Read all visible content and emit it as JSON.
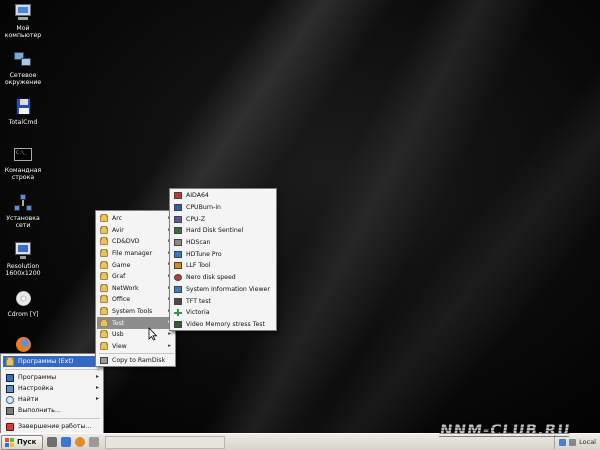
{
  "desktop": {
    "icons": [
      {
        "label": "Мой компьютер",
        "icon": "computer-icon"
      },
      {
        "label": "Сетевое окружение",
        "icon": "network-icon"
      },
      {
        "label": "TotalCmd",
        "icon": "total-commander-icon"
      },
      {
        "label": "Командная строка",
        "icon": "command-prompt-icon"
      },
      {
        "label": "Установка сети",
        "icon": "network-setup-icon"
      },
      {
        "label": "Resolution 1600x1200",
        "icon": "monitor-icon"
      },
      {
        "label": "Cdrom [Y]",
        "icon": "cdrom-icon"
      },
      {
        "label": "",
        "icon": "firefox-icon"
      }
    ]
  },
  "start_menu": {
    "items": [
      {
        "label": "Программы (Ext)",
        "icon": "programs-ext-icon",
        "has_submenu": true,
        "selected": true
      },
      {
        "label": "Программы",
        "icon": "programs-icon",
        "has_submenu": true
      },
      {
        "label": "Настройка",
        "icon": "settings-icon",
        "has_submenu": true
      },
      {
        "label": "Найти",
        "icon": "search-icon",
        "has_submenu": true
      },
      {
        "label": "Выполнить...",
        "icon": "run-icon"
      },
      {
        "label": "Завершение работы...",
        "icon": "shutdown-icon"
      }
    ]
  },
  "programs_menu": {
    "items": [
      {
        "label": "Arc",
        "has_submenu": true
      },
      {
        "label": "Avir",
        "has_submenu": true
      },
      {
        "label": "CD&DVD",
        "has_submenu": true
      },
      {
        "label": "File manager",
        "has_submenu": true
      },
      {
        "label": "Game",
        "has_submenu": true
      },
      {
        "label": "Graf",
        "has_submenu": true
      },
      {
        "label": "NetWork",
        "has_submenu": true
      },
      {
        "label": "Office",
        "has_submenu": true
      },
      {
        "label": "System Tools",
        "has_submenu": true
      },
      {
        "label": "Test",
        "has_submenu": true,
        "selected": true
      },
      {
        "label": "Usb",
        "has_submenu": true
      },
      {
        "label": "View",
        "has_submenu": true
      }
    ],
    "footer_item": "Copy to RamDisk"
  },
  "test_menu": {
    "items": [
      {
        "label": "AIDA64",
        "icon": "aida64-icon",
        "color": "#c0392b"
      },
      {
        "label": "CPUBurn-in",
        "icon": "cpuburn-icon",
        "color": "#2b5fa8"
      },
      {
        "label": "CPU-Z",
        "icon": "cpuz-icon",
        "color": "#5a5a9a"
      },
      {
        "label": "Hard Disk Sentinel",
        "icon": "hdsentinel-icon",
        "color": "#3c6e3c"
      },
      {
        "label": "HDScan",
        "icon": "hdscan-icon",
        "color": "#8a8a8a"
      },
      {
        "label": "HDTune Pro",
        "icon": "hdtune-icon",
        "color": "#2f7fd0"
      },
      {
        "label": "LLF Tool",
        "icon": "llftool-icon",
        "color": "#d78a1a"
      },
      {
        "label": "Nero disk speed",
        "icon": "nero-icon",
        "color": "#c23a3a"
      },
      {
        "label": "System Information Viewer",
        "icon": "siv-icon",
        "color": "#3a7dc9"
      },
      {
        "label": "TFT test",
        "icon": "tft-test-icon",
        "color": "#4a4a4a"
      },
      {
        "label": "Victoria",
        "icon": "victoria-icon",
        "color": "#2e9b3a"
      },
      {
        "label": "Video Memory stress Test",
        "icon": "vmt-icon",
        "color": "#2a5f2a"
      }
    ]
  },
  "taskbar": {
    "start_label": "Пуск",
    "clock": "Local"
  },
  "watermark": "NNM-CLUB.RU"
}
